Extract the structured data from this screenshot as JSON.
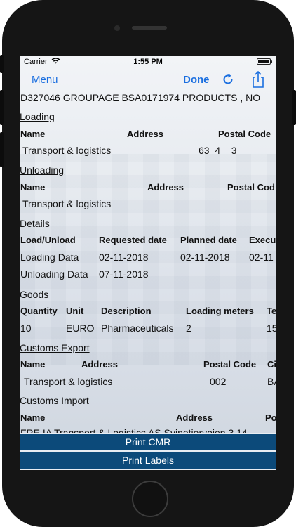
{
  "status_bar": {
    "carrier": "Carrier",
    "time": "1:55 PM"
  },
  "nav": {
    "menu": "Menu",
    "done": "Done",
    "icons": [
      "refresh-icon",
      "share-icon"
    ]
  },
  "header_line": "D327046  GROUPAGE  BSA0171974  PRODUCTS , NO",
  "loading": {
    "title": "Loading",
    "headers": [
      "Name",
      "Address",
      "Postal Code"
    ],
    "row": {
      "name": "Transport & logistics",
      "postal_code": "63  4    3"
    }
  },
  "unloading": {
    "title": "Unloading",
    "headers": [
      "Name",
      "Address",
      "Postal Cod"
    ],
    "row": {
      "name": "Transport & logistics"
    }
  },
  "details": {
    "title": "Details",
    "headers": [
      "Load/Unload",
      "Requested date",
      "Planned date",
      "Execu"
    ],
    "rows": [
      [
        "Loading Data",
        "02-11-2018",
        "02-11-2018",
        "02-11"
      ],
      [
        "Unloading Data",
        "07-11-2018",
        "",
        ""
      ]
    ]
  },
  "goods": {
    "title": "Goods",
    "headers": [
      "Quantity",
      "Unit",
      "Description",
      "Loading meters",
      "Te"
    ],
    "row": [
      "10",
      "EURO",
      "Pharmaceuticals",
      "2",
      "15"
    ]
  },
  "customs_export": {
    "title": "Customs Export",
    "headers": [
      "Name",
      "Address",
      "Postal Code",
      "Ci"
    ],
    "row": {
      "name": "Transport & logistics",
      "postal_code": "002",
      "city": "BA"
    }
  },
  "customs_import": {
    "title": "Customs Import",
    "headers": [
      "Name",
      "Address",
      "Po"
    ],
    "row_partial": "FRE IA Transport & Logistics AS  Svinetiervoien 3  14"
  },
  "buttons": {
    "print_cmr": "Print CMR",
    "print_labels": "Print Labels"
  },
  "colors": {
    "accent": "#1a6fe0",
    "button_bg": "#0c4a7a",
    "phone_body": "#151515"
  }
}
